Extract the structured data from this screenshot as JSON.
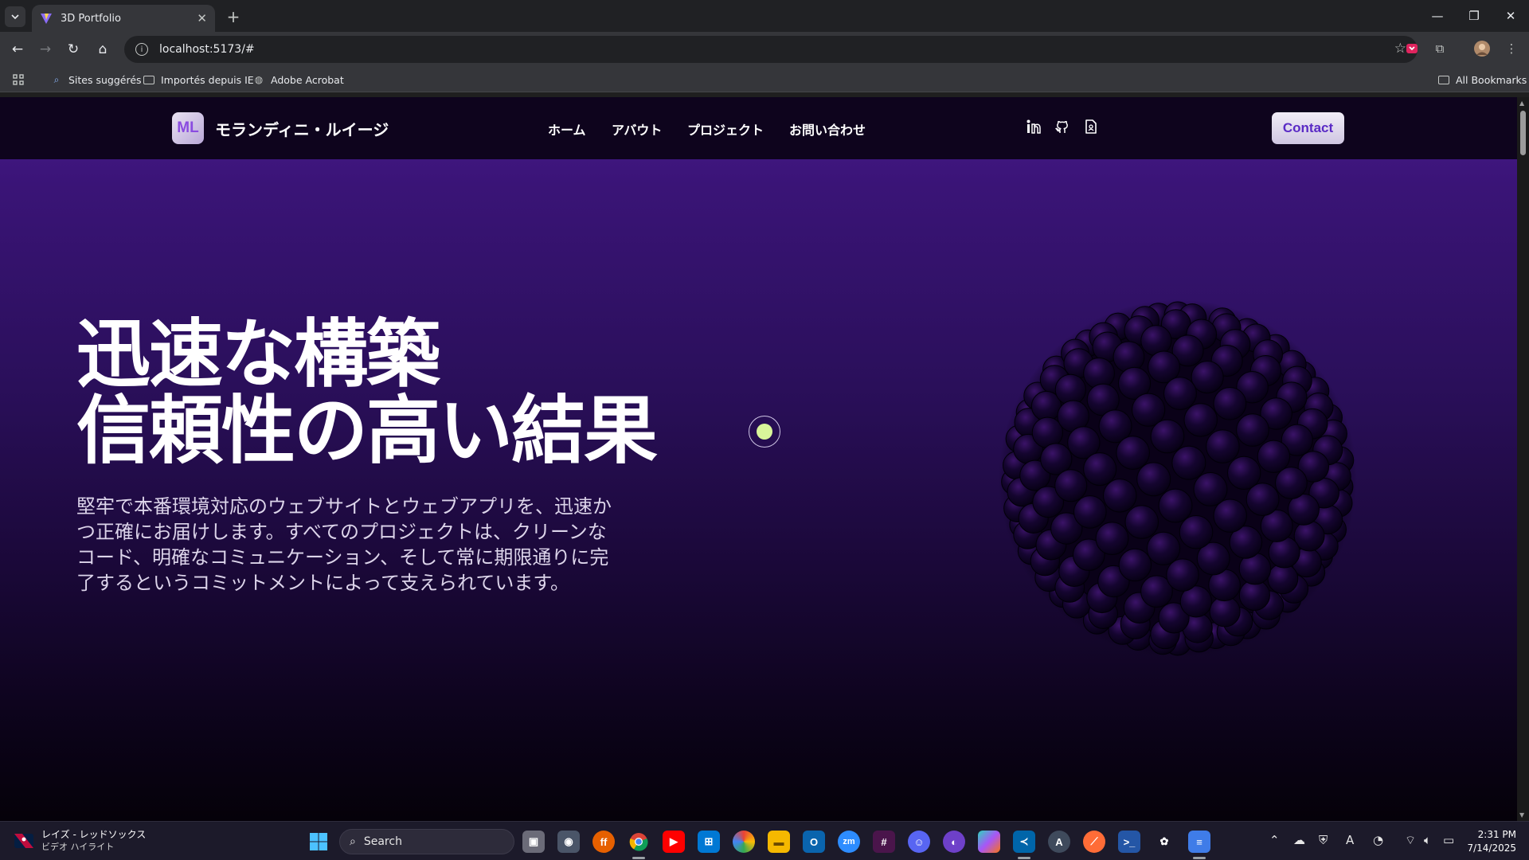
{
  "browser": {
    "tab_title": "3D Portfolio",
    "tab_close": "✕",
    "new_tab": "+",
    "url": "localhost:5173/#",
    "bookmarks": {
      "suggested": "Sites suggérés",
      "imported": "Importés depuis IE",
      "acrobat": "Adobe Acrobat",
      "all": "All Bookmarks"
    }
  },
  "site": {
    "logo_text": "ML",
    "brand_name": "モランディニ・ルイージ",
    "nav": [
      "ホーム",
      "アバウト",
      "プロジェクト",
      "お問い合わせ"
    ],
    "social_icons": [
      "linkedin-icon",
      "github-icon",
      "resume-icon"
    ],
    "contact_label": "Contact",
    "hero": {
      "title_line1": "迅速な構築",
      "title_line2": "信頼性の高い結果",
      "subtitle": "堅牢で本番環境対応のウェブサイトとウェブアプリを、迅速かつ正確にお届けします。すべてのプロジェクトは、クリーンなコード、明確なコミュニケーション、そして常に期限通りに完了するというコミットメントによって支えられています。"
    },
    "colors": {
      "accent": "#5a2ac5",
      "cursor_dot": "#d9f59a",
      "hero_gradient_top": "#4a1a8e",
      "hero_gradient_bottom": "#050109"
    }
  },
  "taskbar": {
    "weather_line1": "レイズ - レッドソックス",
    "weather_line2": "ビデオ ハイライト",
    "search_placeholder": "Search",
    "time": "2:31 PM",
    "date": "7/14/2025"
  }
}
